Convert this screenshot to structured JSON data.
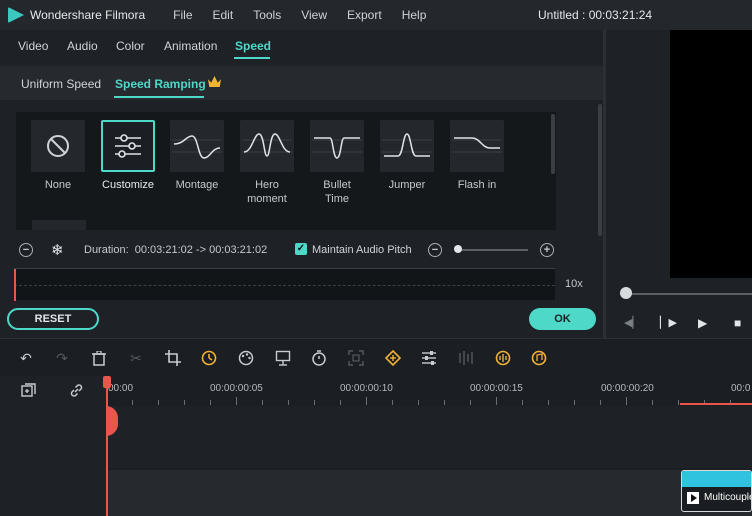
{
  "app": {
    "name": "Wondershare Filmora",
    "document_title": "Untitled : 00:03:21:24"
  },
  "menu": [
    "File",
    "Edit",
    "Tools",
    "View",
    "Export",
    "Help"
  ],
  "tabs": [
    {
      "label": "Video",
      "active": false
    },
    {
      "label": "Audio",
      "active": false
    },
    {
      "label": "Color",
      "active": false
    },
    {
      "label": "Animation",
      "active": false
    },
    {
      "label": "Speed",
      "active": true
    }
  ],
  "subtabs": [
    {
      "label": "Uniform Speed",
      "active": false
    },
    {
      "label": "Speed Ramping",
      "active": true
    }
  ],
  "presets": [
    {
      "label": "None",
      "icon": "no-icon",
      "selected": false
    },
    {
      "label": "Customize",
      "icon": "sliders-icon",
      "selected": true
    },
    {
      "label": "Montage",
      "icon": "montage-curve-icon",
      "selected": false
    },
    {
      "label": "Hero moment",
      "icon": "hero-curve-icon",
      "selected": false
    },
    {
      "label": "Bullet Time",
      "icon": "bullet-curve-icon",
      "selected": false
    },
    {
      "label": "Jumper",
      "icon": "jumper-curve-icon",
      "selected": false
    },
    {
      "label": "Flash in",
      "icon": "flash-curve-icon",
      "selected": false
    }
  ],
  "duration": {
    "label": "Duration:",
    "value": "00:03:21:02 -> 00:03:21:02"
  },
  "maintain_audio_pitch": {
    "label": "Maintain Audio Pitch",
    "checked": true
  },
  "speed_max_label": "10x",
  "buttons": {
    "reset": "RESET",
    "ok": "OK"
  },
  "timeline": {
    "ruler": [
      "00:00",
      "00:00:00:05",
      "00:00:00:10",
      "00:00:00:15",
      "00:00:00:20",
      "00:0"
    ],
    "clip_name": "Multicouple"
  },
  "colors": {
    "accent": "#4ed8c8",
    "playhead": "#e8574a",
    "clip": "#2fc3e0",
    "crown": "#f2b234"
  }
}
